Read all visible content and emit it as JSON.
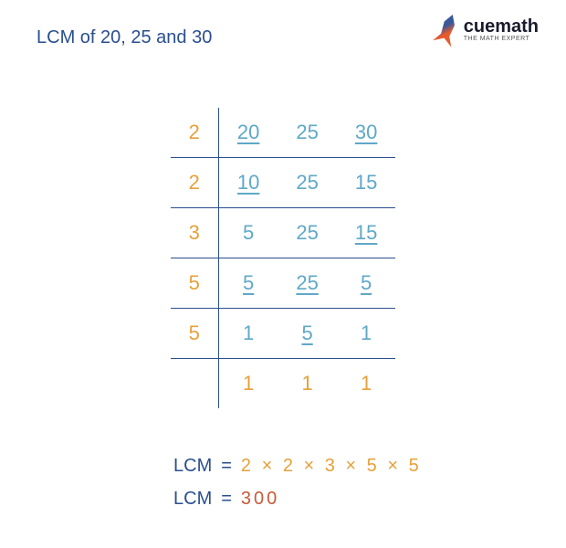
{
  "title": "LCM of 20, 25 and 30",
  "logo": {
    "brand": "cuemath",
    "tagline": "THE MATH EXPERT"
  },
  "table": {
    "rows": [
      {
        "divisor": "2",
        "values": [
          "20",
          "25",
          "30"
        ],
        "underlined": [
          true,
          false,
          true
        ]
      },
      {
        "divisor": "2",
        "values": [
          "10",
          "25",
          "15"
        ],
        "underlined": [
          true,
          false,
          false
        ]
      },
      {
        "divisor": "3",
        "values": [
          "5",
          "25",
          "15"
        ],
        "underlined": [
          false,
          false,
          true
        ]
      },
      {
        "divisor": "5",
        "values": [
          "5",
          "25",
          "5"
        ],
        "underlined": [
          true,
          true,
          true
        ]
      },
      {
        "divisor": "5",
        "values": [
          "1",
          "5",
          "1"
        ],
        "underlined": [
          false,
          true,
          false
        ]
      },
      {
        "divisor": "",
        "values": [
          "1",
          "1",
          "1"
        ],
        "underlined": [
          false,
          false,
          false
        ],
        "last": true
      }
    ]
  },
  "result": {
    "label": "LCM",
    "equals": "=",
    "factors": "2 × 2 × 3 × 5 × 5",
    "value": "300"
  }
}
